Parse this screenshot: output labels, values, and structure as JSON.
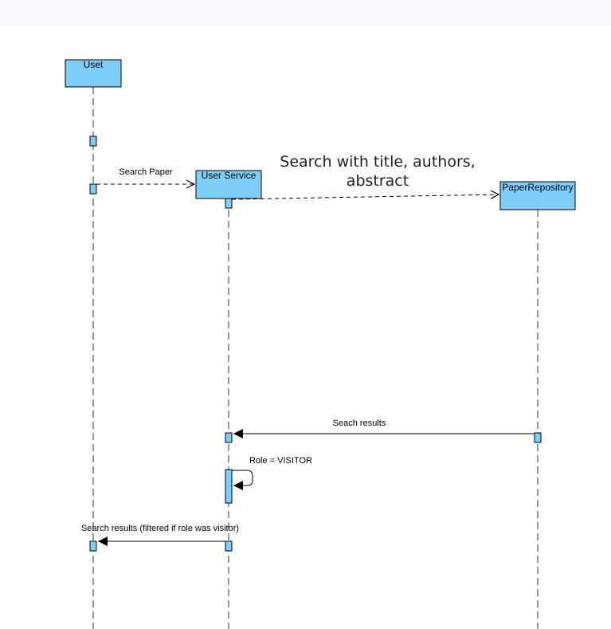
{
  "colors": {
    "box_fill": "#7dcef8",
    "stroke": "#000000",
    "lifeline": "#555555",
    "topbar": "#f8f9fa"
  },
  "participants": {
    "user": "Uset",
    "user_service": "User Service",
    "paper_repository": "PaperRepository"
  },
  "messages": {
    "search_paper": "Search Paper",
    "search_with_line1": "Search with title, authors,",
    "search_with_line2": "abstract",
    "search_results": "Seach results",
    "role_visitor": "Role = VISITOR",
    "filtered_results": "Search results (filtered if role was visitor)"
  }
}
